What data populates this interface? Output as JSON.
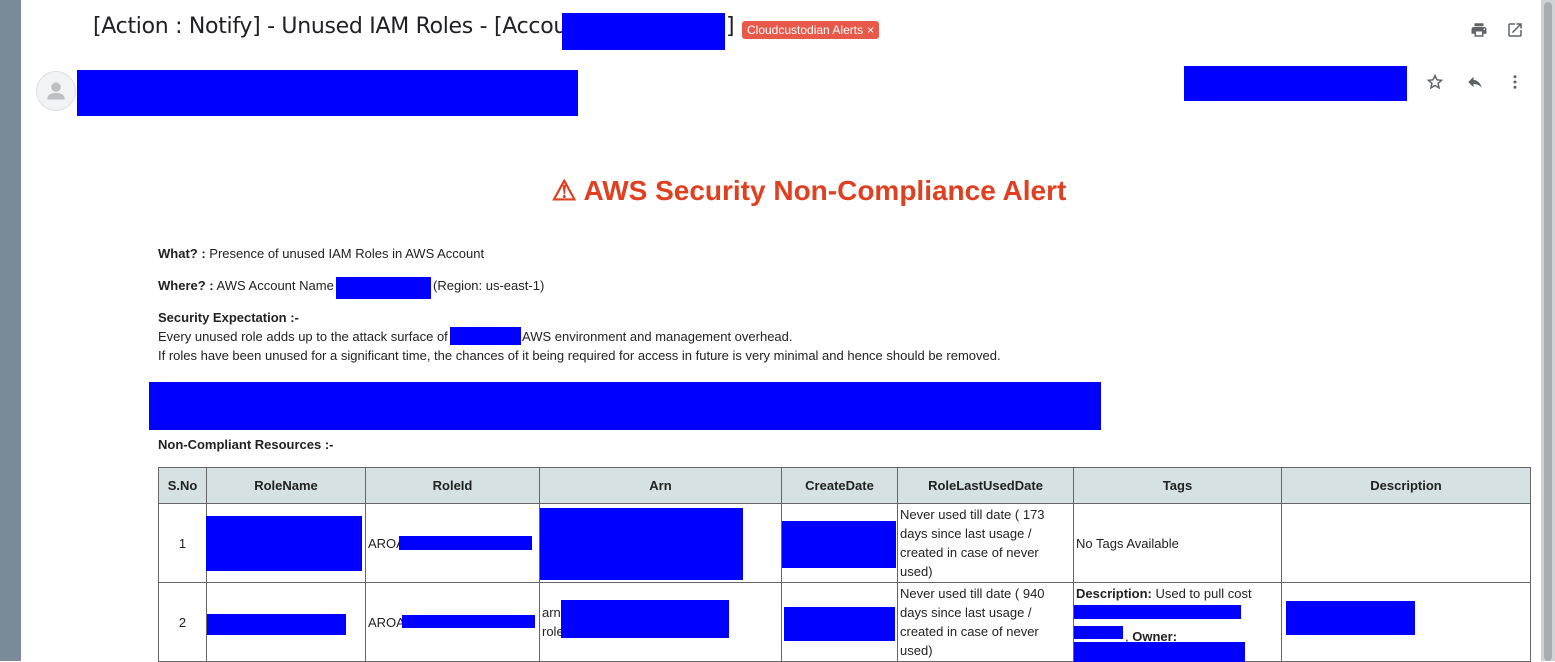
{
  "email": {
    "subject": "[Action : Notify] - Unused IAM Roles - [Account:",
    "subject_close": "]",
    "label": "Cloudcustodian Alerts",
    "label_close": "×",
    "icons": [
      "print-icon",
      "open-in-new-window-icon",
      "avatar-icon",
      "star-icon",
      "reply-icon",
      "more-vertical-icon"
    ]
  },
  "alert": {
    "icon": "⚠",
    "title": "AWS Security Non-Compliance Alert"
  },
  "body": {
    "what_label": "What? :",
    "what_text": "Presence of unused IAM Roles in AWS Account",
    "where_label": "Where? :",
    "where_text_1": "AWS Account Name",
    "where_text_2": "(Region: us-east-1)",
    "security_label": "Security Expectation :-",
    "security_line1_a": "Every unused role adds up to the attack surface of",
    "security_line1_b": "AWS environment and management overhead.",
    "security_line2": "If roles have been unused for a significant time, the chances of it being required for access in future is very minimal and hence should be removed.",
    "noncompliant_label": "Non-Compliant Resources :-"
  },
  "table": {
    "headers": [
      "S.No",
      "RoleName",
      "RoleId",
      "Arn",
      "CreateDate",
      "RoleLastUsedDate",
      "Tags",
      "Description"
    ],
    "rows": [
      {
        "sno": "1",
        "roleid_prefix": "AROA",
        "last_used": "Never used till date ( 173 days since last usage / created in case of never used)",
        "tags": "No Tags Available"
      },
      {
        "sno": "2",
        "roleid_prefix": "AROA",
        "arn_prefix_1": "arn",
        "arn_prefix_2": "role",
        "last_used": "Never used till date ( 940 days since last usage / created in case of never used)",
        "tags_desc_label": "Description:",
        "tags_desc_text": "Used to pull cost",
        "tags_owner_label": "Owner:"
      }
    ]
  },
  "colors": {
    "alert_red": "#e0401f",
    "redaction": "#0000ff",
    "label_chip": "#e8594a",
    "table_header": "#d5e1e2"
  }
}
